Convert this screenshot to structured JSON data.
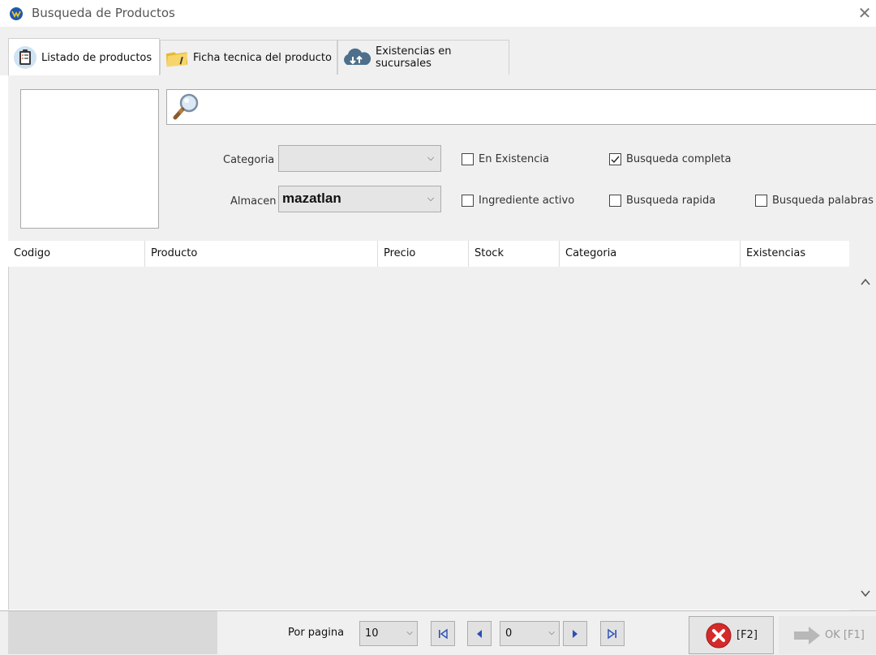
{
  "window": {
    "title": "Busqueda de Productos",
    "close_glyph": "✕"
  },
  "tabs": [
    {
      "label": "Listado de productos",
      "icon": "clipboard-list-icon",
      "active": true
    },
    {
      "label": "Ficha tecnica del producto",
      "icon": "folder-icon",
      "active": false
    },
    {
      "label": "Existencias en sucursales",
      "icon": "cloud-sync-icon",
      "active": false
    }
  ],
  "search": {
    "value": "",
    "icon": "magnifier-icon"
  },
  "filters": {
    "categoria_label": "Categoria",
    "categoria_value": "",
    "almacen_label": "Almacen",
    "almacen_value": "mazatlan",
    "checkboxes": [
      {
        "label": "En Existencia",
        "checked": false
      },
      {
        "label": "Busqueda completa",
        "checked": true
      },
      {
        "label": "Ingrediente activo",
        "checked": false
      },
      {
        "label": "Busqueda rapida",
        "checked": false
      },
      {
        "label": "Busqueda palabras",
        "checked": false
      }
    ]
  },
  "table": {
    "columns": [
      "Codigo",
      "Producto",
      "Precio",
      "Stock",
      "Categoria",
      "Existencias"
    ],
    "rows": []
  },
  "pager": {
    "per_page_label": "Por pagina",
    "per_page_value": "10",
    "page_value": "0"
  },
  "actions": {
    "cancel_label": "[F2]",
    "ok_label": "OK [F1]"
  },
  "colors": {
    "panel": "#f0f0f0",
    "cancel_red": "#d42a2a",
    "ok_arrow_disabled": "#b8b8b8",
    "nav_blue": "#2a4fb5"
  }
}
